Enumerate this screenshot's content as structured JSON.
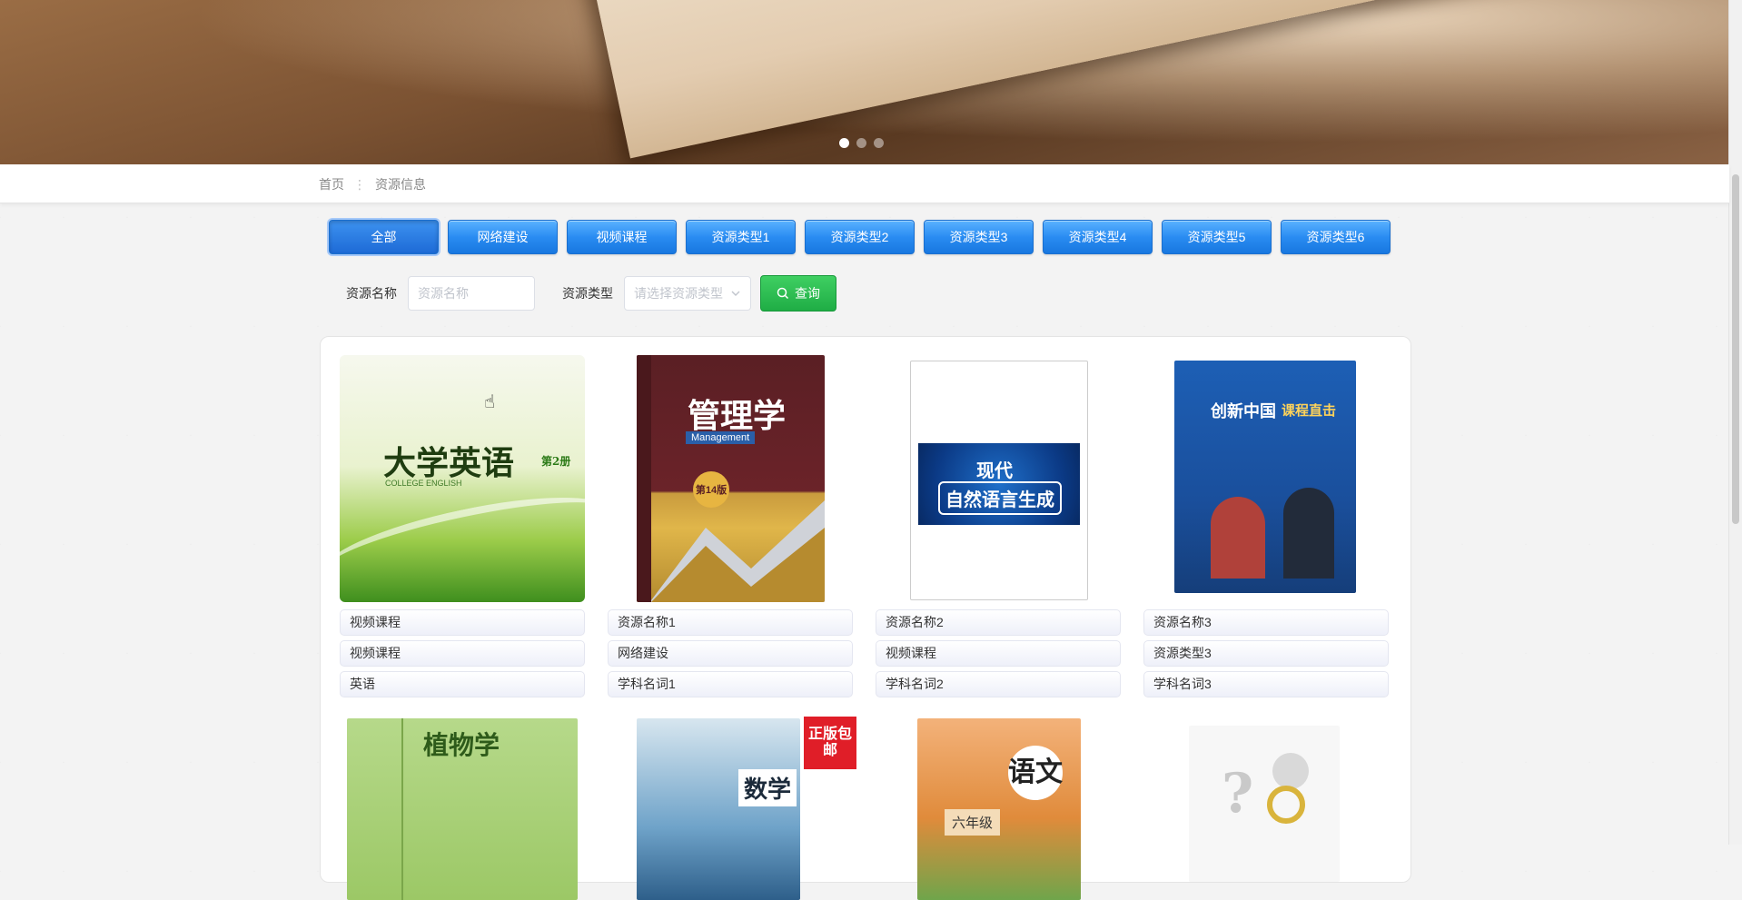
{
  "banner": {
    "slides": 3,
    "active_slide": 1
  },
  "breadcrumb": {
    "home": "首页",
    "separator": "⋮",
    "current": "资源信息"
  },
  "categories": [
    {
      "label": "全部",
      "active": true
    },
    {
      "label": "网络建设"
    },
    {
      "label": "视频课程"
    },
    {
      "label": "资源类型1"
    },
    {
      "label": "资源类型2"
    },
    {
      "label": "资源类型3"
    },
    {
      "label": "资源类型4"
    },
    {
      "label": "资源类型5"
    },
    {
      "label": "资源类型6"
    }
  ],
  "search": {
    "name_label": "资源名称",
    "name_placeholder": "资源名称",
    "type_label": "资源类型",
    "type_placeholder": "请选择资源类型",
    "query_label": "查询"
  },
  "items": [
    {
      "cover_title": "大学英语",
      "cover_sub": "COLLEGE ENGLISH",
      "cover_badge": "第2册",
      "name": "视频课程",
      "type": "视频课程",
      "subject": "英语"
    },
    {
      "cover_title": "管理学",
      "cover_sub": "Management",
      "cover_badge": "第14版",
      "name": "资源名称1",
      "type": "网络建设",
      "subject": "学科名词1"
    },
    {
      "cover_title": "现代",
      "cover_sub": "自然语言生成",
      "name": "资源名称2",
      "type": "视频课程",
      "subject": "学科名词2"
    },
    {
      "cover_title": "创新中国",
      "cover_sub": "课程直击",
      "name": "资源名称3",
      "type": "资源类型3",
      "subject": "学科名词3"
    }
  ],
  "row2_covers": [
    {
      "cover_title": "植物学"
    },
    {
      "cover_title": "数学",
      "cover_badge": "正版包邮"
    },
    {
      "cover_title": "语文",
      "cover_sub": "六年级"
    },
    {
      "cover_title": "?"
    }
  ],
  "colors": {
    "primary": "#2a8cf2",
    "success": "#1fad45"
  }
}
